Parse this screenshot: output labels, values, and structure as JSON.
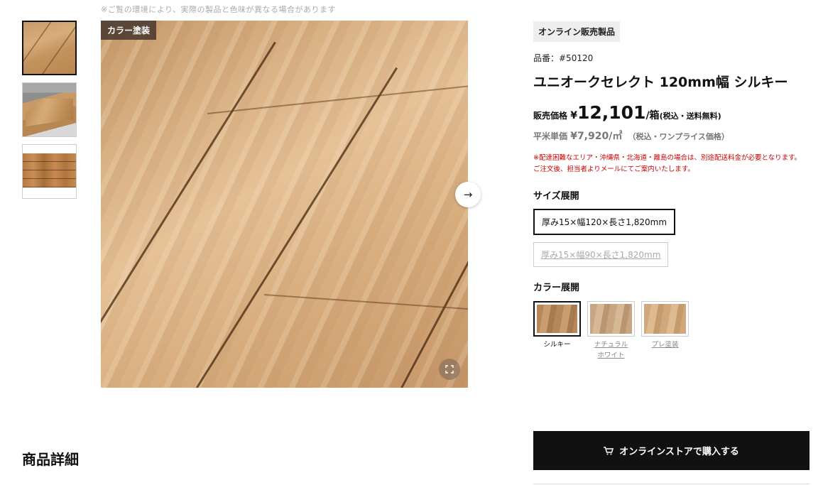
{
  "notice": "※ご覧の環境により、実際の製品と色味が異なる場合があります",
  "gallery": {
    "color_label": "カラー塗装",
    "thumbnails": [
      "thumb-1",
      "thumb-2",
      "thumb-3"
    ],
    "next_icon": "→",
    "expand_icon": "⛶"
  },
  "product": {
    "badge": "オンライン販売製品",
    "number": "品番：#50120",
    "title": "ユニオークセレクト 120mm幅 シルキー",
    "price_label": "販売価格",
    "price_currency": "¥",
    "price_value": "12,101",
    "price_unit": "/箱",
    "price_note": "(税込・送料無料)",
    "sqm_label": "平米単価",
    "sqm_value": "¥7,920/㎡",
    "sqm_note": "（税込・ワンプライス価格）",
    "warning_1": "※配達困難なエリア・沖縄県・北海道・離島の場合は、別途配送料金が必要となります。",
    "warning_2": "ご注文後、担当者よりメールにてご案内いたします。"
  },
  "size_section": {
    "heading": "サイズ展開",
    "options": [
      {
        "label": "厚み15×幅120×長さ1,820mm",
        "selected": true
      },
      {
        "label": "厚み15×幅90×長さ1,820mm",
        "selected": false
      }
    ]
  },
  "color_section": {
    "heading": "カラー展開",
    "options": [
      {
        "label": "シルキー",
        "selected": true
      },
      {
        "label": "ナチュラル\nホワイト",
        "selected": false
      },
      {
        "label": "プレ塗装",
        "selected": false
      }
    ]
  },
  "buy_button": {
    "icon": "cart-icon",
    "label": "オンラインストアで購入する"
  },
  "details_heading": "商品詳細"
}
